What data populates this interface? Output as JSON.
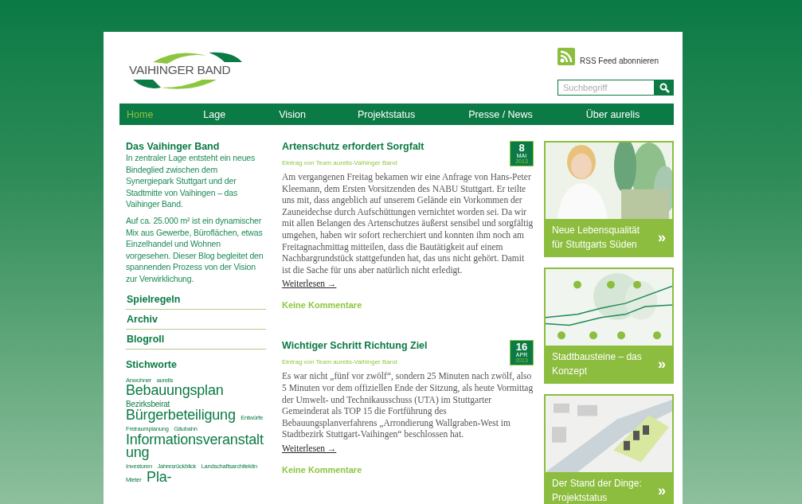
{
  "header": {
    "logo": "VAIHINGER BAND",
    "rss": "RSS Feed abonnieren",
    "search": {
      "placeholder": "Suchbegriff"
    }
  },
  "nav": [
    {
      "label": "Home",
      "selected": true
    },
    {
      "label": "Lage",
      "selected": false
    },
    {
      "label": "Vision",
      "selected": false
    },
    {
      "label": "Projektstatus",
      "selected": false
    },
    {
      "label": "Presse / News",
      "selected": false
    },
    {
      "label": "Über aurelis",
      "selected": false
    }
  ],
  "sidebar": {
    "title": "Das Vaihinger Band",
    "paragraphs": [
      "In zentraler Lage entsteht ein neues Bindeglied zwischen dem Synergiepark Stuttgart und der Stadtmitte von Vaihingen – das Vaihinger Band.",
      "Auf ca. 25.000 m² ist ein dynamischer Mix aus Gewerbe, Büroflächen, etwas Einzelhandel und Wohnen vorgesehen. Dieser Blog begleitet den spannenden Prozess von der Vision zur Verwirklichung."
    ],
    "links": [
      "Spielregeln",
      "Archiv",
      "Blogroll"
    ],
    "tags_title": "Stichworte",
    "tags": [
      {
        "text": "Anwohner",
        "kind": "small"
      },
      {
        "text": "aurelis",
        "kind": "small"
      },
      {
        "text": "Bebauungsplan",
        "kind": "large"
      },
      {
        "text": "Bezirksbeirat",
        "kind": "medium"
      },
      {
        "text": "Bürgerbeteiligung",
        "kind": "large"
      },
      {
        "text": "Entwürfe",
        "kind": "small"
      },
      {
        "text": "Freiraumplanung",
        "kind": "small"
      },
      {
        "text": "Gäubahn",
        "kind": "small"
      },
      {
        "text": "Informationsveranstaltung",
        "kind": "large"
      },
      {
        "text": "Investoren",
        "kind": "small"
      },
      {
        "text": "Jahresrückblick",
        "kind": "small"
      },
      {
        "text": "Landschaftsarchitektin",
        "kind": "small"
      },
      {
        "text": "Mieter",
        "kind": "small"
      },
      {
        "text": "Pla-",
        "kind": "large"
      }
    ]
  },
  "posts": [
    {
      "title": "Artenschutz erfordert Sorgfalt",
      "day": "8",
      "month": "MAI",
      "year": "2013",
      "byline": "Eintrag von Team aurelis-Vaihinger Band",
      "body": "Am vergangenen Freitag bekamen wir eine Anfrage von Hans-Peter Kleemann, dem Ersten Vorsitzenden des NABU Stuttgart. Er teilte uns mit, dass angeblich auf unserem Gelände ein Vorkommen der Zauneidechse durch Aufschüttungen vernichtet worden sei. Da wir mit allen Belangen des Artenschutzes äußerst sensibel und sorgfältig umgehen, haben wir sofort recherchiert und konnten ihm noch am Freitagnachmittag mitteilen, dass die Bautätigkeit auf einem Nachbargrundstück stattgefunden hat, das uns nicht gehört. Damit ist die Sache für uns aber natürlich nicht erledigt.",
      "more": "Weiterlesen →",
      "comments": "Keine Kommentare"
    },
    {
      "title": "Wichtiger Schritt Richtung Ziel",
      "day": "16",
      "month": "APR",
      "year": "2013",
      "byline": "Eintrag von Team aurelis-Vaihinger Band",
      "body": "Es war nicht „fünf vor zwölf“, sondern 25 Minuten nach zwölf, also 5 Minuten vor dem offiziellen Ende der Sitzung, als heute Vormittag der Umwelt- und Technikausschuss (UTA) im Stuttgarter Gemeinderat als TOP 15 die Fortführung des Bebauungsplanverfahrens „Arrondierung Wallgraben-West im Stadtbezirk Stuttgart-Vaihingen“ beschlossen hat.",
      "more": "Weiterlesen →",
      "comments": "Keine Kommentare"
    }
  ],
  "teasers": [
    {
      "text": "Neue Lebensqualität für Stuttgarts Süden",
      "arrow": "»"
    },
    {
      "kind": "diagram",
      "text": "Stadtbausteine – das Konzept",
      "arrow": "»"
    },
    {
      "kind": "map",
      "text": "Der Stand der Dinge: Projektstatus",
      "arrow": "»"
    }
  ]
}
